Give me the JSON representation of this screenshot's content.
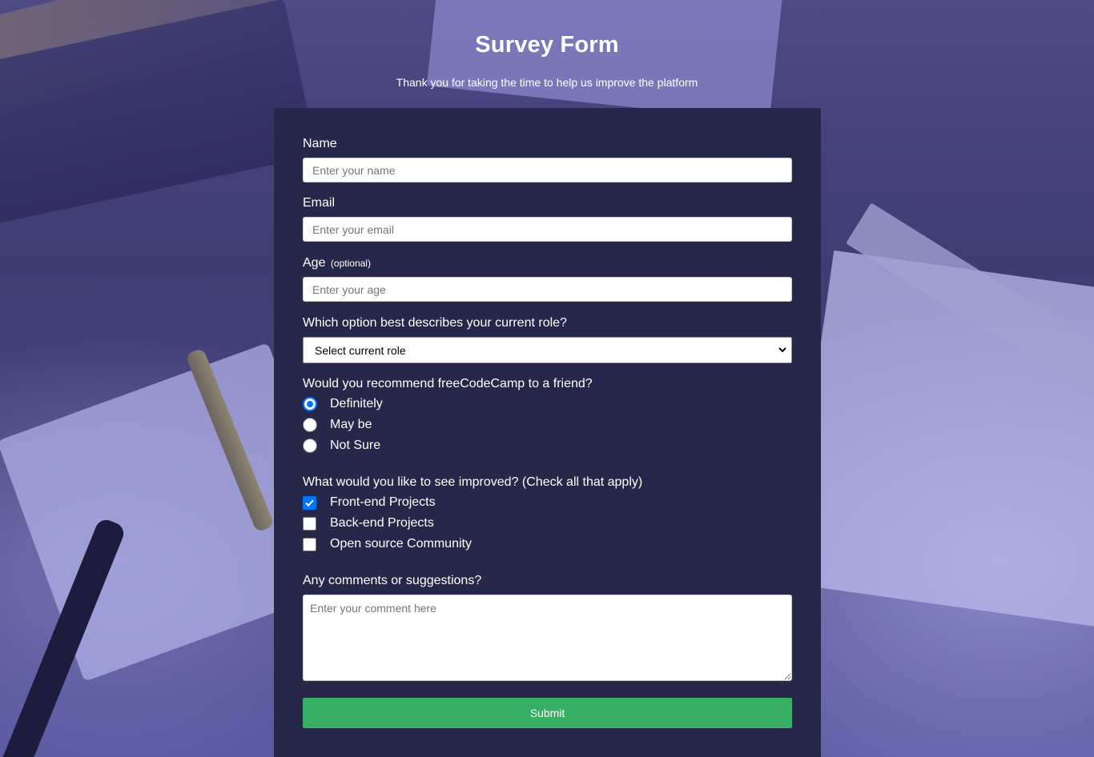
{
  "header": {
    "title": "Survey Form",
    "description": "Thank you for taking the time to help us improve the platform"
  },
  "form": {
    "name": {
      "label": "Name",
      "placeholder": "Enter your name"
    },
    "email": {
      "label": "Email",
      "placeholder": "Enter your email"
    },
    "age": {
      "label": "Age",
      "optional": "(optional)",
      "placeholder": "Enter your age"
    },
    "role": {
      "label": "Which option best describes your current role?",
      "selected": "Select current role"
    },
    "recommend": {
      "label": "Would you recommend freeCodeCamp to a friend?",
      "options": [
        "Definitely",
        "May be",
        "Not Sure"
      ],
      "selected_index": 0
    },
    "improve": {
      "label": "What would you like to see improved? (Check all that apply)",
      "options": [
        "Front-end Projects",
        "Back-end Projects",
        "Open source Community"
      ],
      "checked": [
        true,
        false,
        false
      ]
    },
    "comments": {
      "label": "Any comments or suggestions?",
      "placeholder": "Enter your comment here"
    },
    "submit_label": "Submit"
  },
  "colors": {
    "card_bg": "#272849",
    "accent": "#0075ff",
    "submit_bg": "#37af65"
  },
  "icons": {
    "select_arrow": "chevron-down-icon",
    "checkbox_check": "check-icon"
  }
}
